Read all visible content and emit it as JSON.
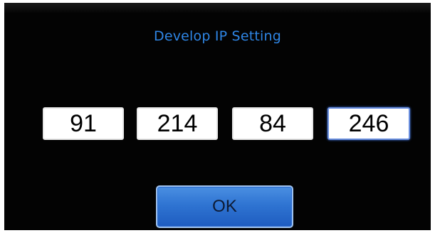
{
  "dialog": {
    "title": "Develop IP Setting",
    "ip_octets": [
      "91",
      "214",
      "84",
      "246"
    ],
    "ok_label": "OK"
  },
  "colors": {
    "background": "#030303",
    "title": "#2f86e6",
    "button": "#2f74d2",
    "field": "#ffffff"
  }
}
